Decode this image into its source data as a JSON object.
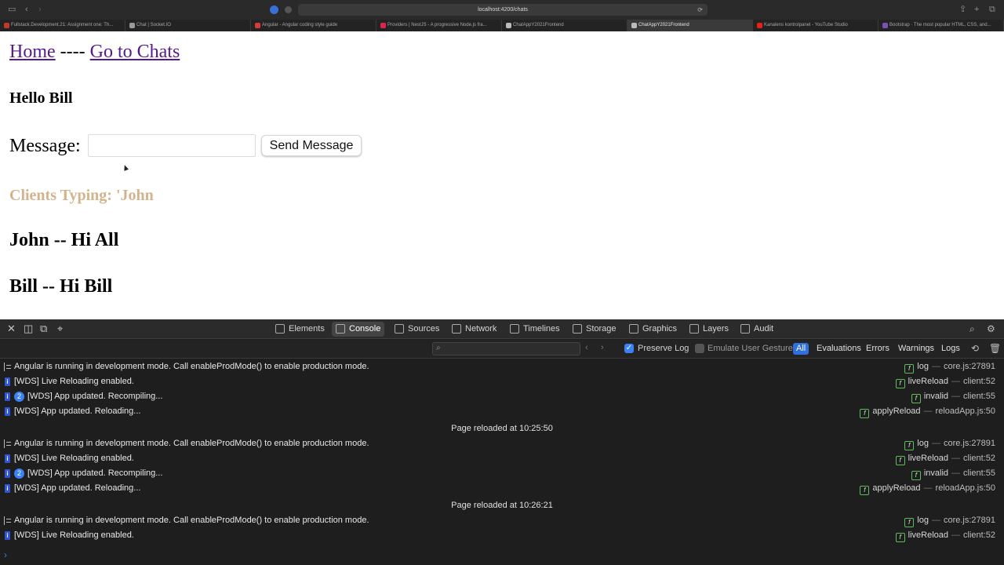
{
  "browser": {
    "url": "localhost:4200/chats",
    "tabs": [
      {
        "label": "Fullstack.Development.21: Assignment one: Th...",
        "color": "#c0392b",
        "active": false
      },
      {
        "label": "Chat | Socket.IO",
        "color": "#9a9a9a",
        "active": false
      },
      {
        "label": "Angular - Angular coding style guide",
        "color": "#d63b3b",
        "active": false
      },
      {
        "label": "Providers | NestJS - A progressive Node.js fra...",
        "color": "#e0234e",
        "active": false
      },
      {
        "label": "ChatAppY2021Frontend",
        "color": "#bbbbbb",
        "active": false
      },
      {
        "label": "ChatAppY2021Frontend",
        "color": "#bbbbbb",
        "active": true
      },
      {
        "label": "Kanalens kontrolpanel - YouTube Studio",
        "color": "#e62117",
        "active": false
      },
      {
        "label": "Bootstrap · The most popular HTML, CSS, and...",
        "color": "#7952b3",
        "active": false
      }
    ]
  },
  "page": {
    "nav": {
      "home": "Home",
      "separator": "----",
      "chats": "Go to Chats"
    },
    "greeting": "Hello Bill",
    "message_label": "Message:",
    "message_value": "",
    "send_label": "Send Message",
    "typing": "Clients Typing: 'John",
    "messages": [
      "John -- Hi All",
      "Bill -- Hi Bill"
    ]
  },
  "devtools": {
    "tabs": [
      "Elements",
      "Console",
      "Sources",
      "Network",
      "Timelines",
      "Storage",
      "Graphics",
      "Layers",
      "Audit"
    ],
    "active_tab": "Console",
    "filter_value": "",
    "preserve_log": "Preserve Log",
    "emulate_gesture": "Emulate User Gesture",
    "levels": [
      "All",
      "Evaluations",
      "Errors",
      "Warnings",
      "Logs"
    ],
    "active_level": "All",
    "console": [
      {
        "kind": "log",
        "text": "Angular is running in development mode. Call enableProdMode() to enable production mode.",
        "func": "log",
        "file": "core.js:27891"
      },
      {
        "kind": "info",
        "text": "[WDS] Live Reloading enabled.",
        "func": "liveReload",
        "file": "client:52"
      },
      {
        "kind": "info",
        "count": "2",
        "text": "[WDS] App updated. Recompiling...",
        "func": "invalid",
        "file": "client:55"
      },
      {
        "kind": "info",
        "text": "[WDS] App updated. Reloading...",
        "func": "applyReload",
        "file": "reloadApp.js:50"
      },
      {
        "kind": "separator",
        "text": "Page reloaded at 10:25:50"
      },
      {
        "kind": "log",
        "text": "Angular is running in development mode. Call enableProdMode() to enable production mode.",
        "func": "log",
        "file": "core.js:27891"
      },
      {
        "kind": "info",
        "text": "[WDS] Live Reloading enabled.",
        "func": "liveReload",
        "file": "client:52"
      },
      {
        "kind": "info",
        "count": "2",
        "text": "[WDS] App updated. Recompiling...",
        "func": "invalid",
        "file": "client:55"
      },
      {
        "kind": "info",
        "text": "[WDS] App updated. Reloading...",
        "func": "applyReload",
        "file": "reloadApp.js:50"
      },
      {
        "kind": "separator",
        "text": "Page reloaded at 10:26:21"
      },
      {
        "kind": "log",
        "text": "Angular is running in development mode. Call enableProdMode() to enable production mode.",
        "func": "log",
        "file": "core.js:27891"
      },
      {
        "kind": "info",
        "text": "[WDS] Live Reloading enabled.",
        "func": "liveReload",
        "file": "client:52"
      }
    ]
  }
}
